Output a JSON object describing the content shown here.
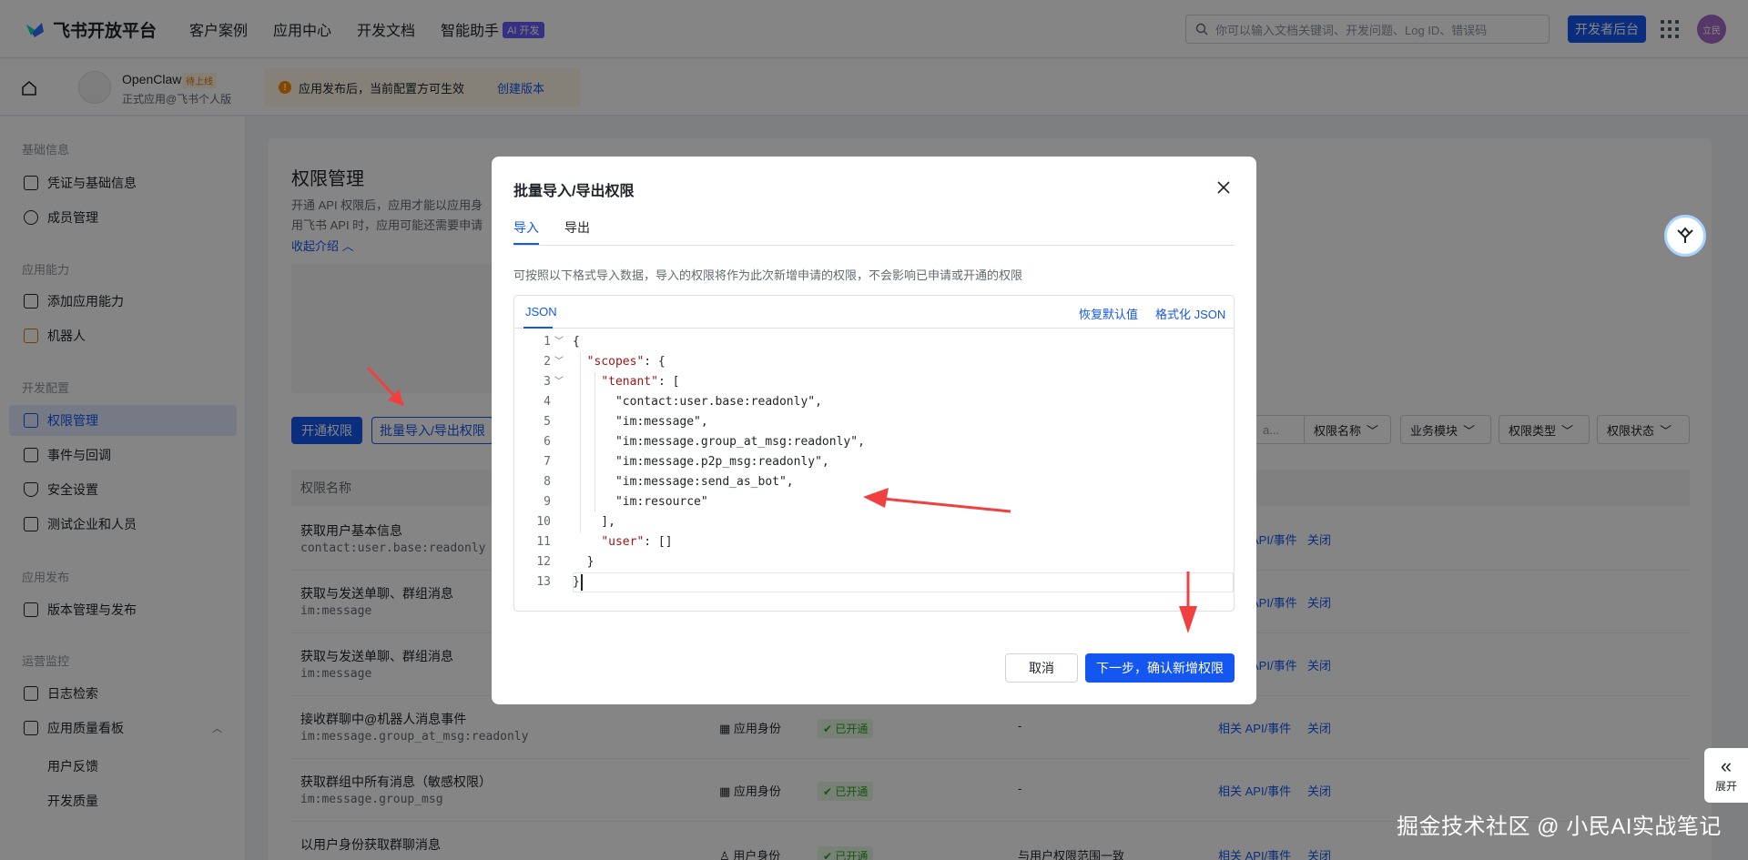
{
  "topnav": {
    "brand": "飞书开放平台",
    "links": [
      "客户案例",
      "应用中心",
      "开发文档",
      "智能助手"
    ],
    "ai_badge": "AI 开发",
    "search_placeholder": "你可以输入文档关键词、开发问题、Log ID、错误码",
    "dev_console": "开发者后台",
    "avatar_text": "立民"
  },
  "app": {
    "name": "OpenClaw",
    "tag": "待上线",
    "subtitle": "正式应用@飞书个人版",
    "notice": "应用发布后，当前配置方可生效",
    "notice_link": "创建版本"
  },
  "sidebar": {
    "sections": [
      {
        "title": "基础信息",
        "items": [
          "凭证与基础信息",
          "成员管理"
        ]
      },
      {
        "title": "应用能力",
        "items": [
          "添加应用能力",
          "机器人"
        ]
      },
      {
        "title": "开发配置",
        "items": [
          "权限管理",
          "事件与回调",
          "安全设置",
          "测试企业和人员"
        ]
      },
      {
        "title": "应用发布",
        "items": [
          "版本管理与发布"
        ]
      },
      {
        "title": "运营监控",
        "items": [
          "日志检索",
          "应用质量看板"
        ]
      }
    ],
    "sub_items": [
      "用户反馈",
      "开发质量"
    ],
    "active": "权限管理"
  },
  "page": {
    "title": "权限管理",
    "desc1": "开通 API 权限后，应用才能以应用身",
    "desc2": "用飞书 API 时，应用可能还需要申请",
    "collapse": "收起介绍",
    "btn_open": "开通权限",
    "btn_batch": "批量导入/导出权限",
    "filters": [
      "权限名称",
      "业务模块",
      "权限类型",
      "权限状态"
    ],
    "search_stub": "a...",
    "col_name": "权限名称",
    "rows": [
      {
        "name": "获取用户基本信息",
        "code": "contact:user.base:readonly",
        "identity": "",
        "status": "",
        "range": "",
        "link1": "API/事件",
        "link2": "关闭"
      },
      {
        "name": "获取与发送单聊、群组消息",
        "code": "im:message",
        "identity": "",
        "status": "",
        "range": "",
        "link1": "API/事件",
        "link2": "关闭"
      },
      {
        "name": "获取与发送单聊、群组消息",
        "code": "im:message",
        "identity": "",
        "status": "",
        "range": "",
        "link1": "API/事件",
        "link2": "关闭"
      },
      {
        "name": "接收群聊中@机器人消息事件",
        "code": "im:message.group_at_msg:readonly",
        "identity": "应用身份",
        "status": "已开通",
        "range": "-",
        "link1": "相关 API/事件",
        "link2": "关闭"
      },
      {
        "name": "获取群组中所有消息（敏感权限）",
        "code": "im:message.group_msg",
        "identity": "应用身份",
        "status": "已开通",
        "range": "-",
        "link1": "相关 API/事件",
        "link2": "关闭"
      },
      {
        "name": "以用户身份获取群聊消息",
        "code": "",
        "identity": "用户身份",
        "status": "已开通",
        "range": "与用户权限范围一致",
        "link1": "相关 API/事件",
        "link2": "关闭"
      }
    ]
  },
  "modal": {
    "title": "批量导入/导出权限",
    "tabs": [
      "导入",
      "导出"
    ],
    "active_tab": "导入",
    "hint": "可按照以下格式导入数据，导入的权限将作为此次新增申请的权限，不会影响已申请或开通的权限",
    "editor_tab": "JSON",
    "reset": "恢复默认值",
    "format": "格式化 JSON",
    "code_lines": [
      "{",
      "  \"scopes\": {",
      "    \"tenant\": [",
      "      \"contact:user.base:readonly\",",
      "      \"im:message\",",
      "      \"im:message.group_at_msg:readonly\",",
      "      \"im:message.p2p_msg:readonly\",",
      "      \"im:message:send_as_bot\",",
      "      \"im:resource\"",
      "    ],",
      "    \"user\": []",
      "  }",
      "}"
    ],
    "cancel": "取消",
    "confirm": "下一步，确认新增权限"
  },
  "floating": {
    "expand": "展开"
  },
  "watermark": "掘金技术社区 @ 小民AI实战笔记",
  "colors": {
    "primary": "#1456f0",
    "arrow": "#f04040",
    "success": "#2ea121"
  }
}
